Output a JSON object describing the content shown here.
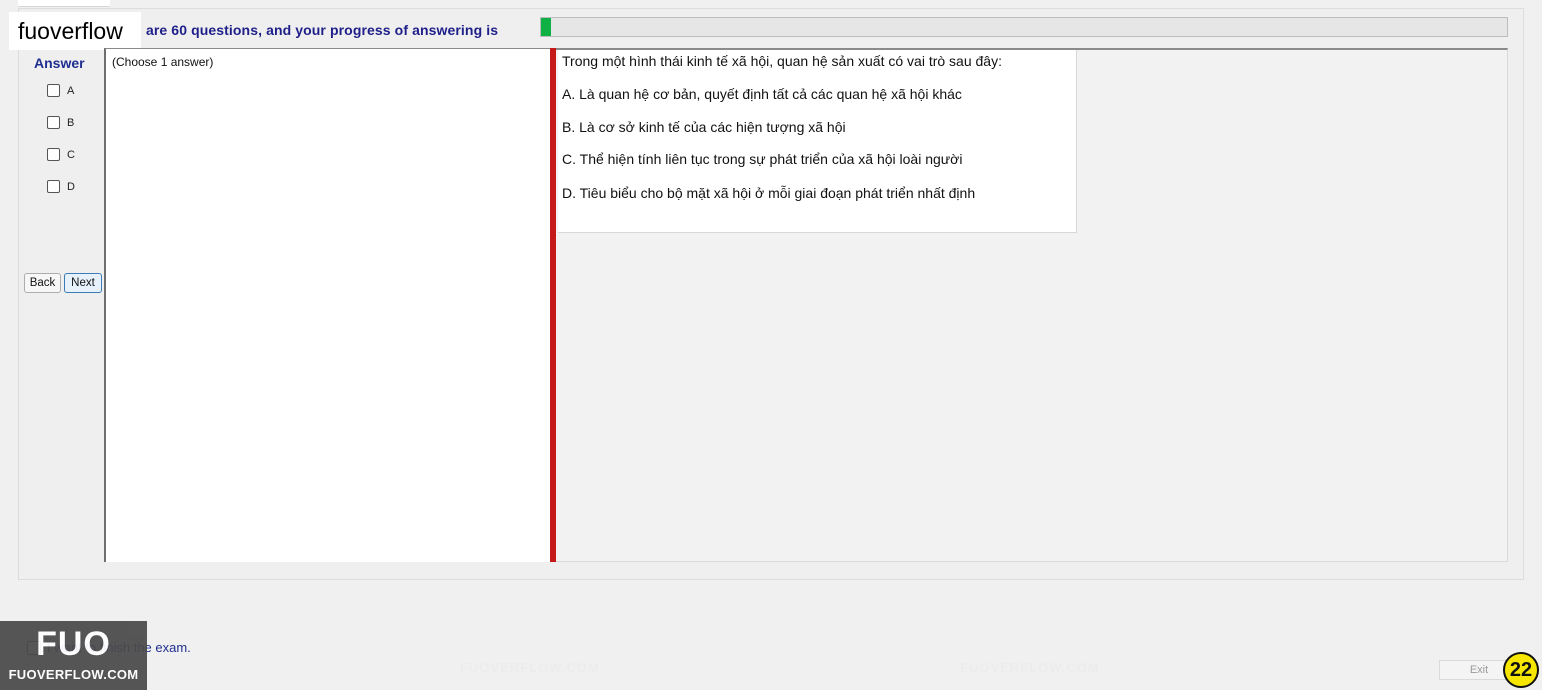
{
  "header": {
    "watermark_label": "fuoverflow",
    "progress_text": "are 60 questions, and your progress of answering is",
    "progress_fraction": 0.01,
    "progress_color": "#0fb044"
  },
  "answer_panel": {
    "title": "Answer",
    "options": [
      "A",
      "B",
      "C",
      "D"
    ],
    "back_label": "Back",
    "next_label": "Next"
  },
  "left_pane": {
    "instruction": "(Choose 1 answer)"
  },
  "question": {
    "stem": "Trong một hình thái kinh tế xã hội, quan hệ sản xuất có vai trò sau đây:",
    "choices": [
      "A.  Là quan hệ cơ bản, quyết định tất cả các quan hệ xã hội khác",
      "B.  Là cơ sở kinh tế của các hiện tượng xã hội",
      "C.  Thể hiện tính liên tục trong sự phát triển của xã hội loài người",
      "D.  Tiêu biểu cho bộ mặt xã hội ở mỗi giai đoạn phát triển nhất định"
    ]
  },
  "watermark": {
    "site": "FUOVERFLOW.COM",
    "badge_big": "FUO",
    "badge_small": "FUOVERFLOW.COM"
  },
  "footer": {
    "finish_text": "I want to finish the exam.",
    "exit_label": "Exit",
    "page_badge": "22"
  }
}
